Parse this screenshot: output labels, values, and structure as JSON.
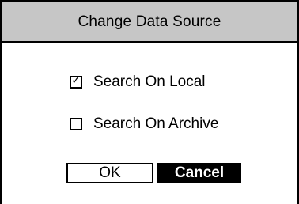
{
  "dialog": {
    "title": "Change Data Source"
  },
  "options": [
    {
      "label": "Search On Local",
      "checked": true,
      "mark": "✓"
    },
    {
      "label": "Search On Archive",
      "checked": false,
      "mark": ""
    }
  ],
  "buttons": {
    "ok_label": "OK",
    "cancel_label": "Cancel"
  },
  "colors": {
    "titlebar_bg": "#c6c6c6",
    "selected_button_bg": "#000000",
    "selected_button_text": "#ffffff"
  }
}
